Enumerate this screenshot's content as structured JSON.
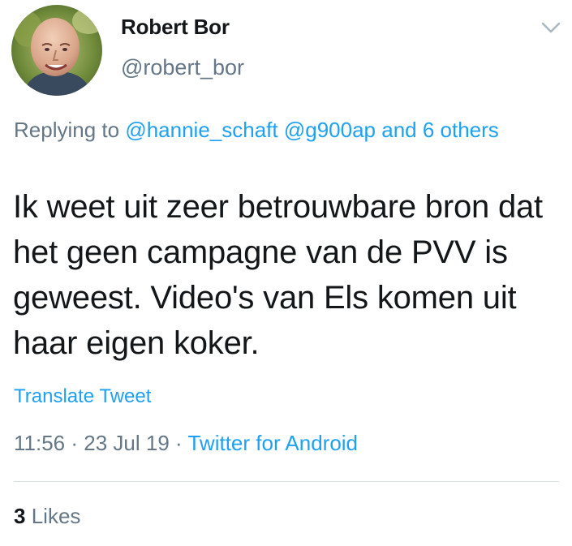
{
  "user": {
    "display_name": "Robert Bor",
    "handle": "@robert_bor"
  },
  "reply": {
    "prefix": "Replying to",
    "mention_1": "@hannie_schaft",
    "mention_2": "@g900ap",
    "suffix": "and 6 others"
  },
  "tweet": {
    "text": "Ik weet uit zeer betrouwbare bron dat het geen campagne van de PVV is geweest. Video's van Els komen uit haar eigen koker."
  },
  "actions": {
    "translate": "Translate Tweet"
  },
  "meta": {
    "time": "11:56",
    "separator": "·",
    "date": "23 Jul 19",
    "source": "Twitter for Android"
  },
  "stats": {
    "likes_count": "3",
    "likes_label": "Likes"
  },
  "icons": {
    "menu": "chevron-down-icon"
  },
  "colors": {
    "link": "#1da1f2",
    "secondary_text": "#657786",
    "primary_text": "#14171a"
  }
}
